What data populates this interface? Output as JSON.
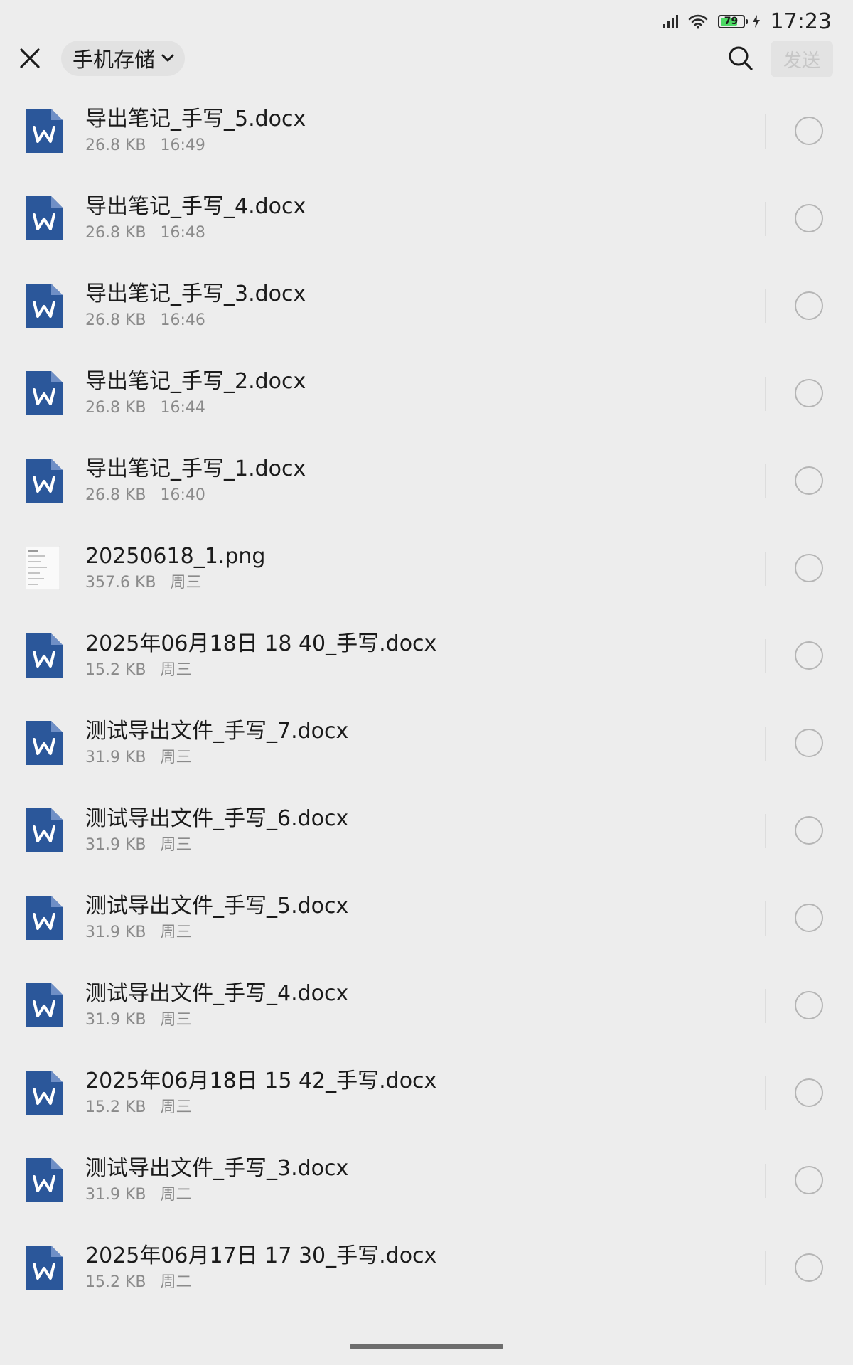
{
  "status_bar": {
    "time": "17:23",
    "battery_level": "79",
    "battery_fraction": 0.79,
    "icons": [
      "signal-icon",
      "wifi-icon",
      "battery-icon",
      "charging-icon"
    ]
  },
  "top_bar": {
    "close_icon": "close-icon",
    "location": "手机存储",
    "dropdown_icon": "chevron-down-icon",
    "search_icon": "search-icon",
    "send_label": "发送"
  },
  "files": [
    {
      "name": "导出笔记_手写_5.docx",
      "size": "26.8 KB",
      "time": "16:49",
      "type": "word"
    },
    {
      "name": "导出笔记_手写_4.docx",
      "size": "26.8 KB",
      "time": "16:48",
      "type": "word"
    },
    {
      "name": "导出笔记_手写_3.docx",
      "size": "26.8 KB",
      "time": "16:46",
      "type": "word"
    },
    {
      "name": "导出笔记_手写_2.docx",
      "size": "26.8 KB",
      "time": "16:44",
      "type": "word"
    },
    {
      "name": "导出笔记_手写_1.docx",
      "size": "26.8 KB",
      "time": "16:40",
      "type": "word"
    },
    {
      "name": "20250618_1.png",
      "size": "357.6 KB",
      "time": "周三",
      "type": "image"
    },
    {
      "name": "2025年06月18日 18 40_手写.docx",
      "size": "15.2 KB",
      "time": "周三",
      "type": "word"
    },
    {
      "name": "测试导出文件_手写_7.docx",
      "size": "31.9 KB",
      "time": "周三",
      "type": "word"
    },
    {
      "name": "测试导出文件_手写_6.docx",
      "size": "31.9 KB",
      "time": "周三",
      "type": "word"
    },
    {
      "name": "测试导出文件_手写_5.docx",
      "size": "31.9 KB",
      "time": "周三",
      "type": "word"
    },
    {
      "name": "测试导出文件_手写_4.docx",
      "size": "31.9 KB",
      "time": "周三",
      "type": "word"
    },
    {
      "name": "2025年06月18日 15 42_手写.docx",
      "size": "15.2 KB",
      "time": "周三",
      "type": "word"
    },
    {
      "name": "测试导出文件_手写_3.docx",
      "size": "31.9 KB",
      "time": "周二",
      "type": "word"
    },
    {
      "name": "2025年06月17日 17 30_手写.docx",
      "size": "15.2 KB",
      "time": "周二",
      "type": "word"
    }
  ],
  "colors": {
    "background": "#ededed",
    "word_icon": "#2b579a",
    "word_icon_fold": "#6f8fc6",
    "battery_fill": "#4cd964",
    "radio_border": "#b5b5b5",
    "meta_text": "#8a8a8a"
  }
}
